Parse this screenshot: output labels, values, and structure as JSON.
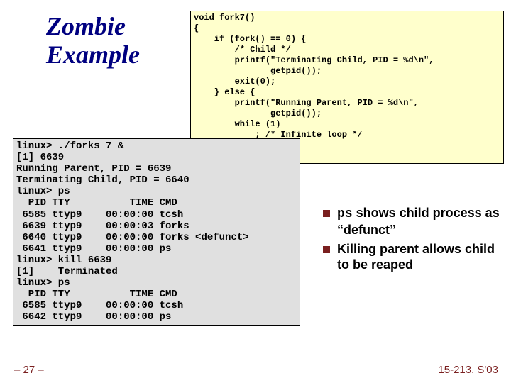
{
  "title_line1": "Zombie",
  "title_line2": "Example",
  "code": "void fork7()\n{\n    if (fork() == 0) {\n        /* Child */\n        printf(\"Terminating Child, PID = %d\\n\",\n               getpid());\n        exit(0);\n    } else {\n        printf(\"Running Parent, PID = %d\\n\",\n               getpid());\n        while (1)\n            ; /* Infinite loop */\n    }\n}",
  "terminal": "linux> ./forks 7 &\n[1] 6639\nRunning Parent, PID = 6639\nTerminating Child, PID = 6640\nlinux> ps\n  PID TTY          TIME CMD\n 6585 ttyp9    00:00:00 tcsh\n 6639 ttyp9    00:00:03 forks\n 6640 ttyp9    00:00:00 forks <defunct>\n 6641 ttyp9    00:00:00 ps\nlinux> kill 6639\n[1]    Terminated\nlinux> ps\n  PID TTY          TIME CMD\n 6585 ttyp9    00:00:00 tcsh\n 6642 ttyp9    00:00:00 ps",
  "bullet1_cmd": "ps",
  "bullet1_rest": " shows child process as “defunct”",
  "bullet2": "Killing parent allows child to be reaped",
  "page_num": "– 27 –",
  "course": "15-213, S'03"
}
